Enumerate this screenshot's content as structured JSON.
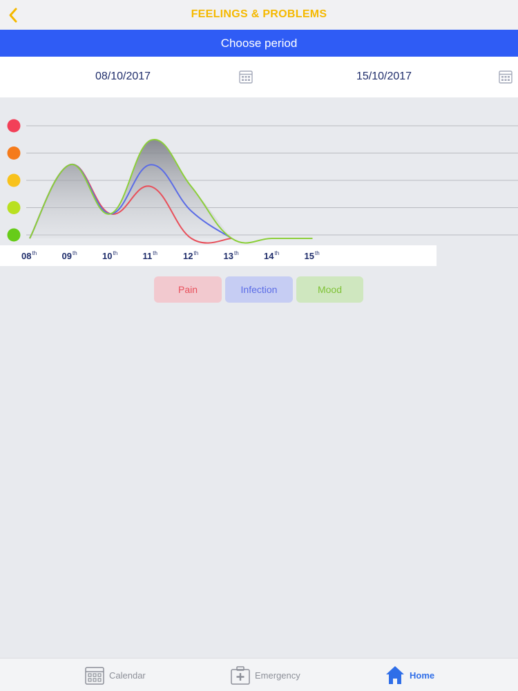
{
  "header": {
    "title": "FEELINGS & PROBLEMS",
    "back_icon": "chevron-left-icon"
  },
  "period": {
    "label": "Choose period"
  },
  "dates": {
    "start": "08/10/2017",
    "end": "15/10/2017",
    "calendar_icon": "calendar-icon"
  },
  "colors": {
    "accent": "#2f5cf5",
    "title": "#f5b900",
    "pain": "#e8505b",
    "infection": "#5b6ce6",
    "mood": "#8ccf3a",
    "levels": [
      "#f24058",
      "#f57b1b",
      "#f8c21c",
      "#b9e021",
      "#67cc19"
    ]
  },
  "chart_data": {
    "type": "area",
    "y_levels": 5,
    "levels_shown_as": "colored dots (red top, green bottom)",
    "categories": [
      "08",
      "09",
      "10",
      "11",
      "12",
      "13",
      "14",
      "15"
    ],
    "category_suffix": "th",
    "grid": true,
    "series": [
      {
        "name": "Pain",
        "values": [
          0,
          2.7,
          0.9,
          1.9,
          0,
          0,
          null,
          null
        ]
      },
      {
        "name": "Infection",
        "values": [
          0,
          2.7,
          0.9,
          2.7,
          1.0,
          0,
          null,
          null
        ]
      },
      {
        "name": "Mood",
        "values": [
          0,
          2.7,
          0.9,
          3.6,
          1.9,
          0,
          0,
          0
        ]
      }
    ]
  },
  "legend": [
    "Pain",
    "Infection",
    "Mood"
  ],
  "tabs": [
    {
      "label": "Calendar",
      "icon": "calendar-icon"
    },
    {
      "label": "Emergency",
      "icon": "first-aid-kit-icon"
    },
    {
      "label": "Home",
      "icon": "home-icon"
    }
  ]
}
